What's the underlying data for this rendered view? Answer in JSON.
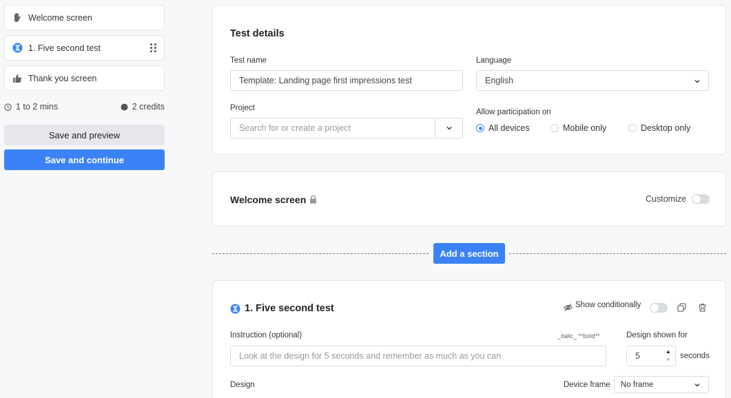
{
  "sidebar": {
    "items": [
      {
        "label": "Welcome screen",
        "icon": "wave-hand-icon"
      },
      {
        "label": "1. Five second test",
        "icon": "timer-icon"
      },
      {
        "label": "Thank you screen",
        "icon": "thumbs-up-icon"
      }
    ],
    "duration": "1 to 2 mins",
    "credits": "2 credits",
    "save_preview": "Save and preview",
    "save_continue": "Save and continue"
  },
  "test_details": {
    "title": "Test details",
    "test_name_label": "Test name",
    "test_name_value": "Template: Landing page first impressions test",
    "language_label": "Language",
    "language_value": "English",
    "project_label": "Project",
    "project_placeholder": "Search for or create a project",
    "participation_label": "Allow participation on",
    "participation_options": [
      "All devices",
      "Mobile only",
      "Desktop only"
    ],
    "participation_selected": "All devices"
  },
  "welcome": {
    "title": "Welcome screen",
    "customize_label": "Customize"
  },
  "add_section": "Add a section",
  "five_second": {
    "title": "1. Five second test",
    "show_conditionally": "Show conditionally",
    "instruction_label": "Instruction (optional)",
    "format_hint": "_italic_ **bold**",
    "instruction_placeholder": "Look at the design for 5 seconds and remember as much as you can",
    "design_shown_label": "Design shown for",
    "design_shown_value": "5",
    "seconds_label": "seconds",
    "design_label": "Design",
    "device_frame_label": "Device frame",
    "device_frame_value": "No frame"
  },
  "colors": {
    "accent": "#3b82f6",
    "background": "#f7f8fa"
  }
}
